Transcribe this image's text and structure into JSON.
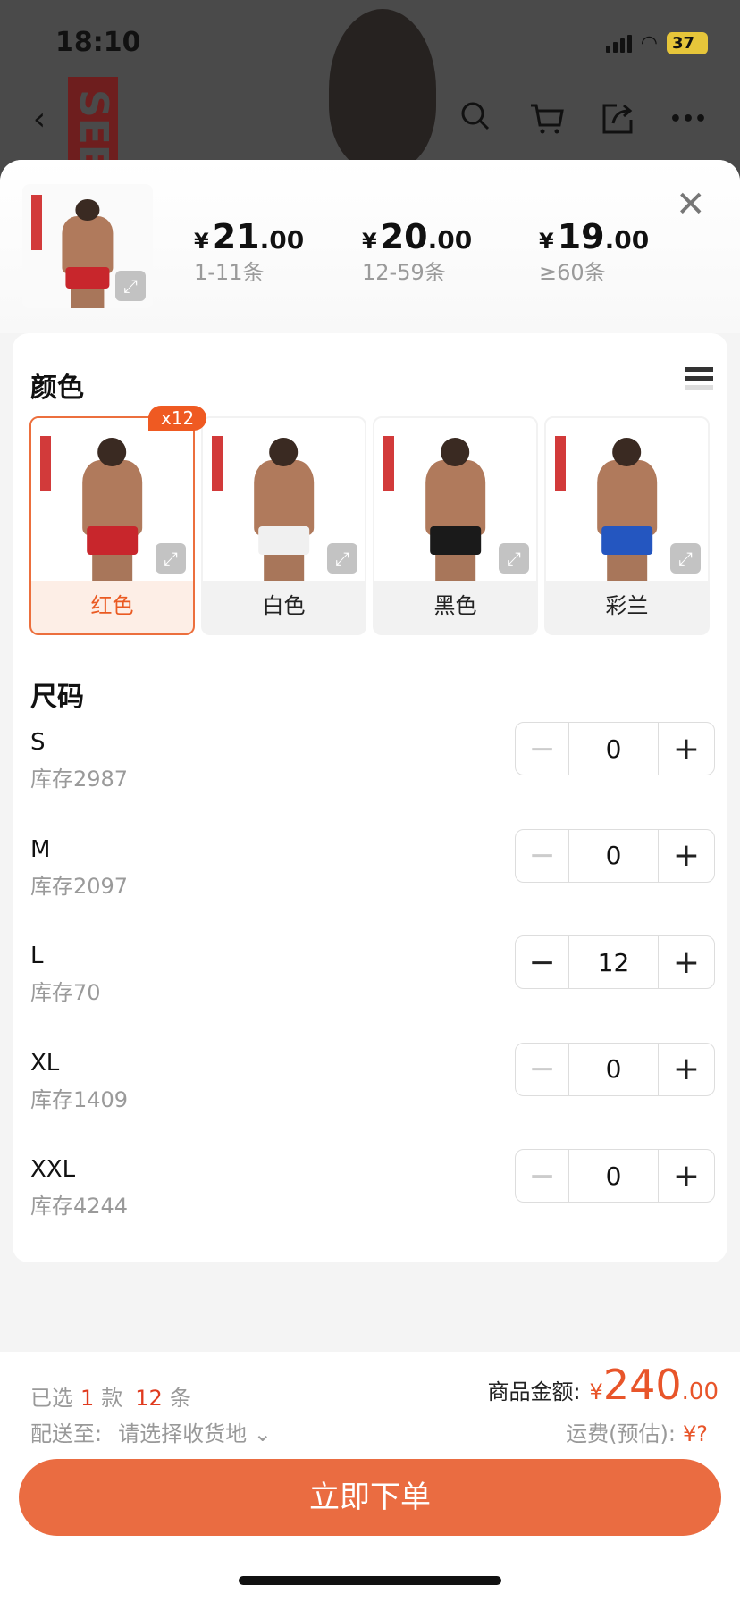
{
  "status_bar": {
    "time": "18:10",
    "battery": "37"
  },
  "nav": {
    "back": "‹",
    "search": "search",
    "cart": "cart",
    "share": "share",
    "more": "•••"
  },
  "backdrop": {
    "brand": "SEE"
  },
  "header": {
    "tiers": [
      {
        "currency": "¥",
        "int": "21",
        "dec": ".00",
        "range": "1-11条"
      },
      {
        "currency": "¥",
        "int": "20",
        "dec": ".00",
        "range": "12-59条"
      },
      {
        "currency": "¥",
        "int": "19",
        "dec": ".00",
        "range": "≥60条"
      }
    ],
    "close": "✕"
  },
  "color_section": {
    "title": "颜色",
    "badge": "x12",
    "options": [
      {
        "label": "红色",
        "pant": "#c8262c",
        "selected": true
      },
      {
        "label": "白色",
        "pant": "#f0f0f0",
        "selected": false
      },
      {
        "label": "黑色",
        "pant": "#1a1a1a",
        "selected": false
      },
      {
        "label": "彩兰",
        "pant": "#2456c0",
        "selected": false
      }
    ]
  },
  "size_section": {
    "title": "尺码",
    "sizes": [
      {
        "size": "S",
        "stock": "库存2987",
        "qty": "0"
      },
      {
        "size": "M",
        "stock": "库存2097",
        "qty": "0"
      },
      {
        "size": "L",
        "stock": "库存70",
        "qty": "12"
      },
      {
        "size": "XL",
        "stock": "库存1409",
        "qty": "0"
      },
      {
        "size": "XXL",
        "stock": "库存4244",
        "qty": "0"
      }
    ]
  },
  "footer": {
    "selected_prefix": "已选",
    "styles_count": "1",
    "styles_unit": "款",
    "items_count": "12",
    "items_unit": "条",
    "ship_label": "配送至:",
    "ship_value": "请选择收货地",
    "ship_chevron": "⌄",
    "total_label": "商品金额:",
    "total_currency": "¥",
    "total_int": "240",
    "total_dec": ".00",
    "fee_label": "运费(预估):",
    "fee_value": "¥?",
    "buy_button": "立即下单"
  }
}
